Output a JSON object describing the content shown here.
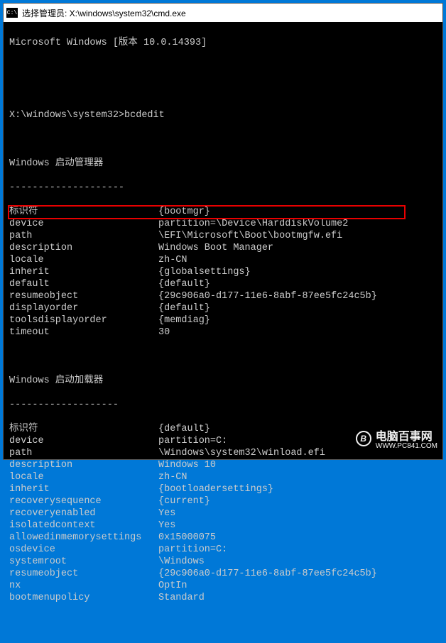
{
  "titlebar": {
    "icon_text": "C:\\",
    "title": "选择管理员: X:\\windows\\system32\\cmd.exe"
  },
  "header": "Microsoft Windows [版本 10.0.14393]",
  "prompt": "X:\\windows\\system32>",
  "command": "bcdedit",
  "sections": {
    "boot_manager": {
      "title": "Windows 启动管理器",
      "divider": "--------------------",
      "entries": [
        {
          "k": "标识符",
          "v": "{bootmgr}"
        },
        {
          "k": "device",
          "v": "partition=\\Device\\HarddiskVolume2"
        },
        {
          "k": "path",
          "v": "\\EFI\\Microsoft\\Boot\\bootmgfw.efi"
        },
        {
          "k": "description",
          "v": "Windows Boot Manager"
        },
        {
          "k": "locale",
          "v": "zh-CN"
        },
        {
          "k": "inherit",
          "v": "{globalsettings}"
        },
        {
          "k": "default",
          "v": "{default}"
        },
        {
          "k": "resumeobject",
          "v": "{29c906a0-d177-11e6-8abf-87ee5fc24c5b}"
        },
        {
          "k": "displayorder",
          "v": "{default}"
        },
        {
          "k": "toolsdisplayorder",
          "v": "{memdiag}"
        },
        {
          "k": "timeout",
          "v": "30"
        }
      ]
    },
    "boot_loader": {
      "title": "Windows 启动加载器",
      "divider": "-------------------",
      "entries": [
        {
          "k": "标识符",
          "v": "{default}"
        },
        {
          "k": "device",
          "v": "partition=C:"
        },
        {
          "k": "path",
          "v": "\\Windows\\system32\\winload.efi"
        },
        {
          "k": "description",
          "v": "Windows 10"
        },
        {
          "k": "locale",
          "v": "zh-CN"
        },
        {
          "k": "inherit",
          "v": "{bootloadersettings}"
        },
        {
          "k": "recoverysequence",
          "v": "{current}"
        },
        {
          "k": "recoveryenabled",
          "v": "Yes"
        },
        {
          "k": "isolatedcontext",
          "v": "Yes"
        },
        {
          "k": "allowedinmemorysettings",
          "v": "0x15000075"
        },
        {
          "k": "osdevice",
          "v": "partition=C:"
        },
        {
          "k": "systemroot",
          "v": "\\Windows"
        },
        {
          "k": "resumeobject",
          "v": "{29c906a0-d177-11e6-8abf-87ee5fc24c5b}"
        },
        {
          "k": "nx",
          "v": "OptIn"
        },
        {
          "k": "bootmenupolicy",
          "v": "Standard"
        }
      ]
    }
  },
  "watermark": {
    "logo": "B",
    "main": "电脑百事网",
    "sub": "WWW.PC841.COM"
  }
}
